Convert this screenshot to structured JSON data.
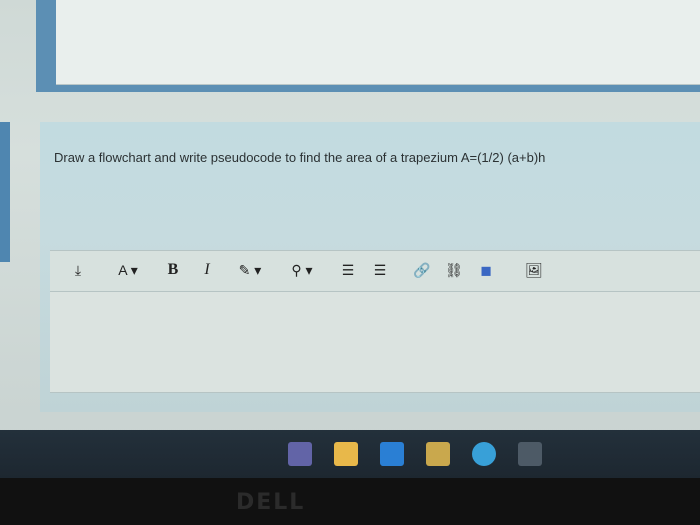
{
  "question": {
    "text": "Draw a flowchart and write pseudocode to find the area of a trapezium A=(1/2) (a+b)h"
  },
  "toolbar": {
    "items": [
      {
        "name": "expand-toolbar-button",
        "label": "⤓"
      },
      {
        "name": "font-size-button",
        "label": "A ▾"
      },
      {
        "name": "bold-button",
        "label": "B"
      },
      {
        "name": "italic-button",
        "label": "I"
      },
      {
        "name": "text-color-button",
        "label": "✎ ▾"
      },
      {
        "name": "highlight-button",
        "label": "⚲ ▾"
      },
      {
        "name": "bullet-list-button",
        "label": "☰"
      },
      {
        "name": "numbered-list-button",
        "label": "☰"
      },
      {
        "name": "link-button",
        "label": "🔗"
      },
      {
        "name": "unlink-button",
        "label": "⛓"
      },
      {
        "name": "media-button",
        "label": "◼"
      },
      {
        "name": "image-button",
        "label": "🖼"
      }
    ]
  },
  "taskbar": {
    "icons": [
      "teams-icon",
      "file-explorer-icon",
      "mail-icon",
      "store-icon",
      "edge-icon",
      "calculator-icon"
    ]
  },
  "bezel": {
    "logo": "DELL"
  }
}
